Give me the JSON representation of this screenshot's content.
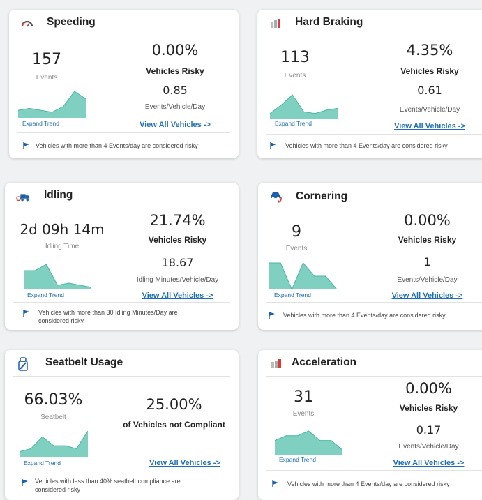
{
  "colors": {
    "accent": "#1f6fb7",
    "spark_fill": "#7fd0c0",
    "spark_line": "#4ab6a3"
  },
  "cards": {
    "speeding": {
      "icon": "speedometer-icon",
      "title": "Speeding",
      "main_value": "157",
      "main_label": "Events",
      "risky_pct": "0.00%",
      "risky_label": "Vehicles Risky",
      "rate": "0.85",
      "rate_label": "Events/Vehicle/Day",
      "expand": "Expand Trend",
      "view_all": "View All Vehicles ->",
      "note": "Vehicles with more than 4 Events/day are considered risky",
      "trend": [
        4,
        5,
        4,
        3,
        6,
        14,
        10
      ]
    },
    "hard_braking": {
      "icon": "hard-braking-icon",
      "title": "Hard Braking",
      "main_value": "113",
      "main_label": "Events",
      "risky_pct": "4.35%",
      "risky_label": "Vehicles Risky",
      "rate": "0.61",
      "rate_label": "Events/Vehicle/Day",
      "expand": "Expand Trend",
      "view_all": "View All Vehicles ->",
      "note": "Vehicles with more than 4 Events/day are considered risky",
      "trend": [
        3,
        8,
        14,
        4,
        3,
        5,
        6
      ]
    },
    "idling": {
      "icon": "idling-truck-icon",
      "title": "Idling",
      "main_value": "2d 09h 14m",
      "main_label": "Idling Time",
      "risky_pct": "21.74%",
      "risky_label": "Vehicles Risky",
      "rate": "18.67",
      "rate_label": "Idling Minutes/Vehicle/Day",
      "expand": "Expand Trend",
      "view_all": "View All Vehicles ->",
      "note": "Vehicles with more than 30 Idling Minutes/Day are considered risky",
      "trend": [
        9,
        9,
        12,
        2,
        3,
        2,
        1
      ]
    },
    "cornering": {
      "icon": "cornering-icon",
      "title": "Cornering",
      "main_value": "9",
      "main_label": "Events",
      "risky_pct": "0.00%",
      "risky_label": "Vehicles Risky",
      "rate": "1",
      "rate_label": "Events/Vehicle/Day",
      "expand": "Expand Trend",
      "view_all": "View All Vehicles ->",
      "note": "Vehicles with more than 4 Events/day are considered risky",
      "trend": [
        6,
        6,
        0,
        6,
        3,
        3,
        0
      ]
    },
    "seatbelt": {
      "icon": "seatbelt-icon",
      "title": "Seatbelt Usage",
      "main_value": "66.03%",
      "main_label": "Seatbelt",
      "non_compliant_pct": "25.00%",
      "non_compliant_label": "of Vehicles not Compliant",
      "expand": "Expand Trend",
      "view_all": "View All Vehicles ->",
      "note": "Vehicles with less than 40% seatbelt compliance are considered risky",
      "trend": [
        2,
        3,
        7,
        4,
        4,
        3,
        9
      ]
    },
    "acceleration": {
      "icon": "acceleration-icon",
      "title": "Acceleration",
      "main_value": "31",
      "main_label": "Events",
      "risky_pct": "0.00%",
      "risky_label": "Vehicles Risky",
      "rate": "0.17",
      "rate_label": "Events/Vehicle/Day",
      "expand": "Expand Trend",
      "view_all": "View All Vehicles ->",
      "note": "Vehicles with more than 4 Events/day are considered risky",
      "trend": [
        3,
        4,
        4,
        5,
        3,
        3,
        1
      ]
    }
  }
}
